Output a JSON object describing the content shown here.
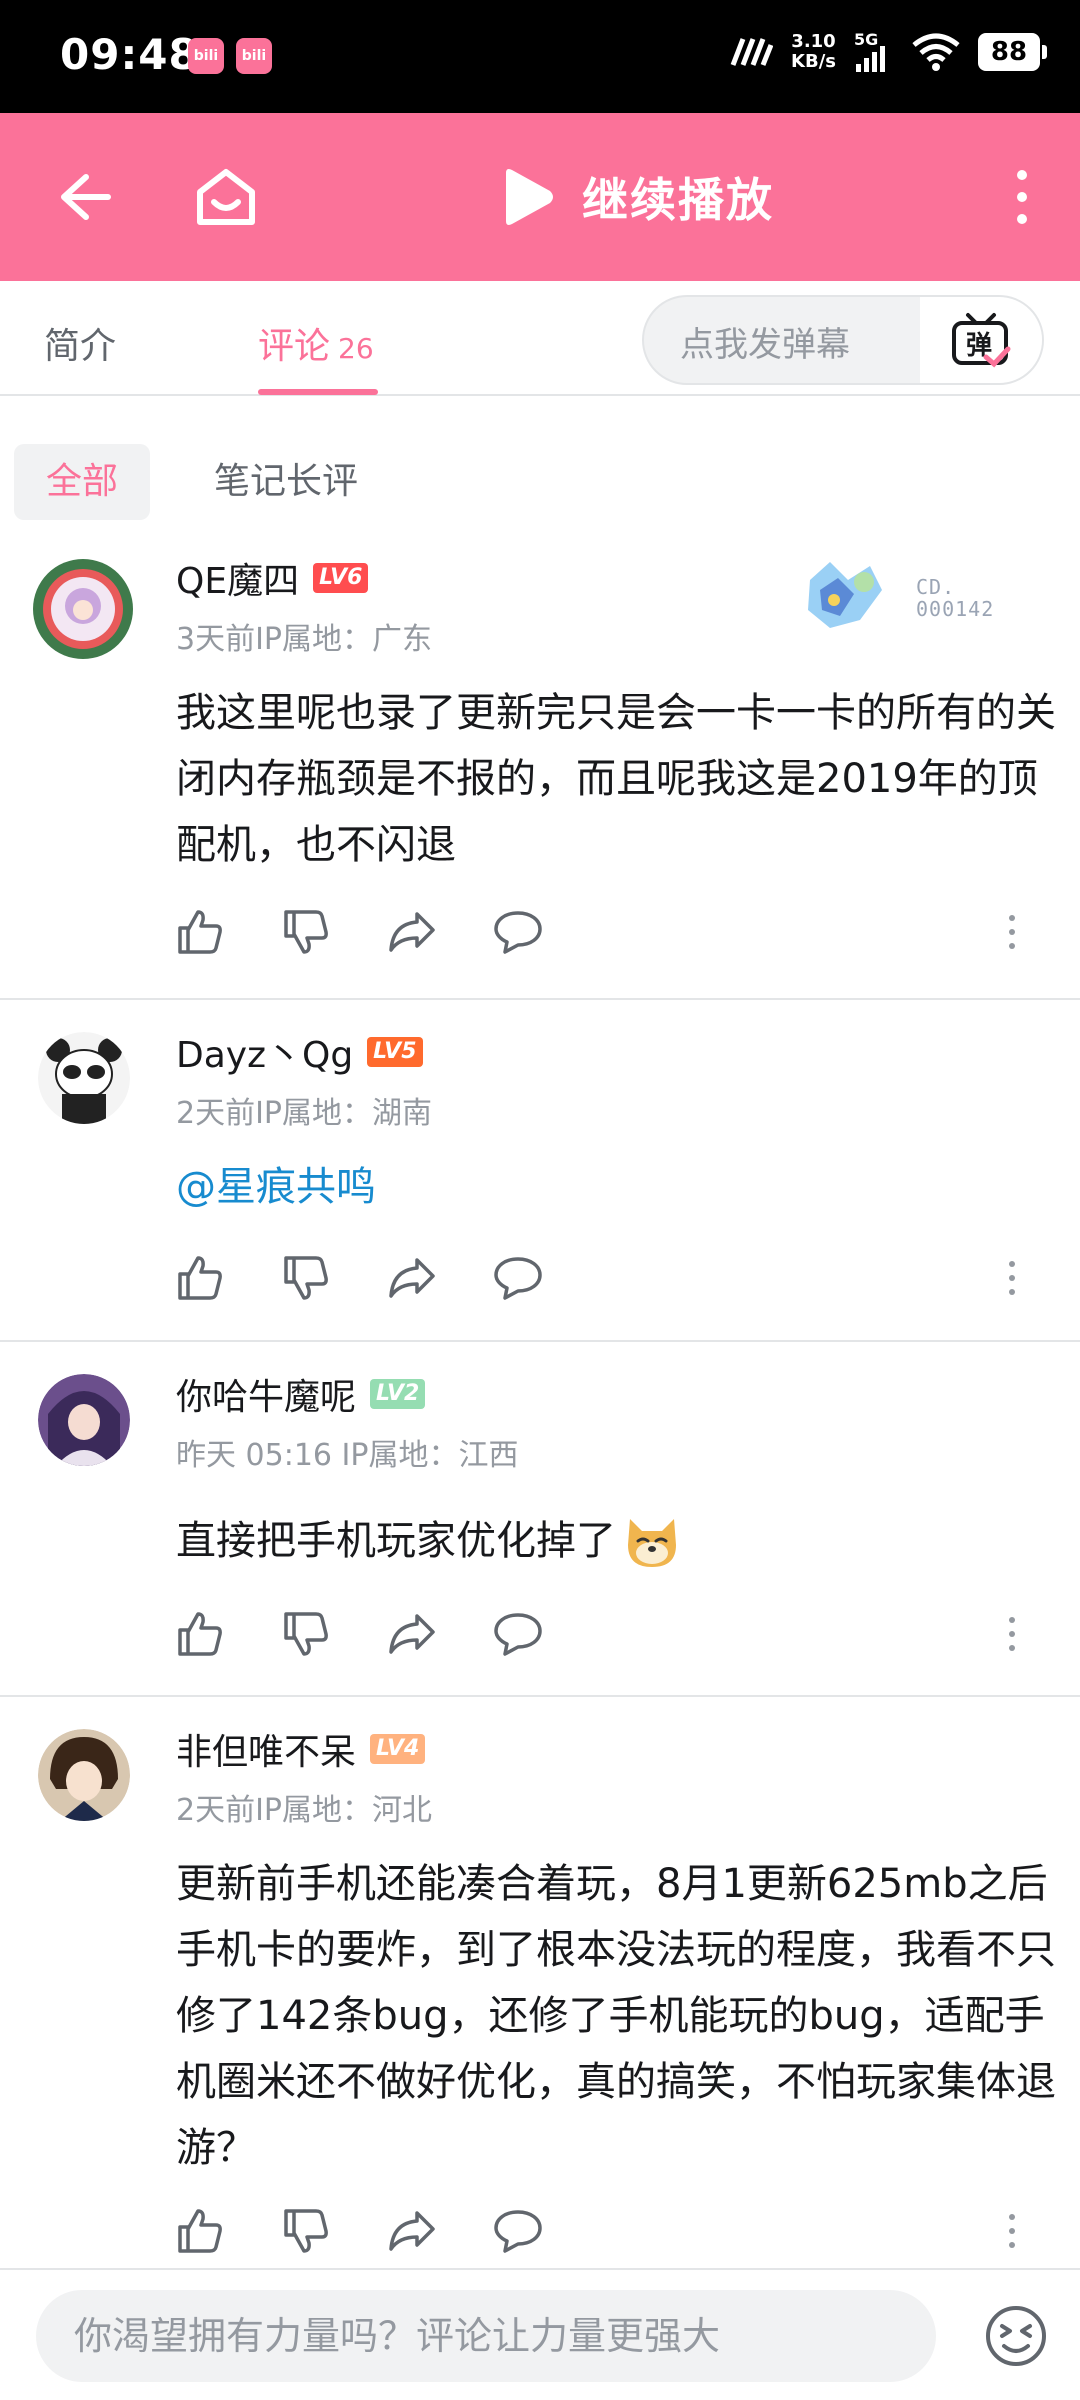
{
  "status_bar": {
    "time": "09:48",
    "app_icon_label": "bili",
    "net_speed_value": "3.10",
    "net_speed_unit": "KB/s",
    "network": "5G",
    "battery": "88"
  },
  "header": {
    "play_label": "继续播放"
  },
  "tabs": {
    "intro": "简介",
    "comments": "评论",
    "comments_count": "26",
    "danmaku_placeholder": "点我发弹幕",
    "danmaku_icon_text": "弹"
  },
  "filters": {
    "all": "全部",
    "notes": "笔记长评"
  },
  "comments": [
    {
      "username": "QE魔四",
      "level": "LV6",
      "level_color": "#ff4d4f",
      "meta": "3天前IP属地：广东",
      "text": "我这里呢也录了更新完只是会一卡一卡的所有的关闭内存瓶颈是不报的，而且呢我这是2019年的顶配机，也不闪退",
      "badge_no_prefix": "CD.",
      "badge_no": "000142"
    },
    {
      "username": "Dayz丶Qg",
      "level": "LV5",
      "level_color": "#ff6a2d",
      "meta": "2天前IP属地：湖南",
      "mention": "@星痕共鸣"
    },
    {
      "username": "你哈牛魔呢",
      "level": "LV2",
      "level_color": "#95ddb2",
      "meta": "昨天 05:16 IP属地：江西",
      "text": "直接把手机玩家优化掉了",
      "emoji": "doge"
    },
    {
      "username": "非但唯不呆",
      "level": "LV4",
      "level_color": "#ffb27f",
      "meta": "2天前IP属地：河北",
      "text": "更新前手机还能凑合着玩，8月1更新625mb之后手机卡的要炸，到了根本没法玩的程度，我看不只修了142条bug，还修了手机能玩的bug，适配手机圈米还不做好优化，真的搞笑，不怕玩家集体退游？"
    }
  ],
  "bottom": {
    "input_placeholder": "你渴望拥有力量吗？评论让力量更强大"
  },
  "colors": {
    "brand": "#fb7299",
    "mention": "#178bcf"
  }
}
